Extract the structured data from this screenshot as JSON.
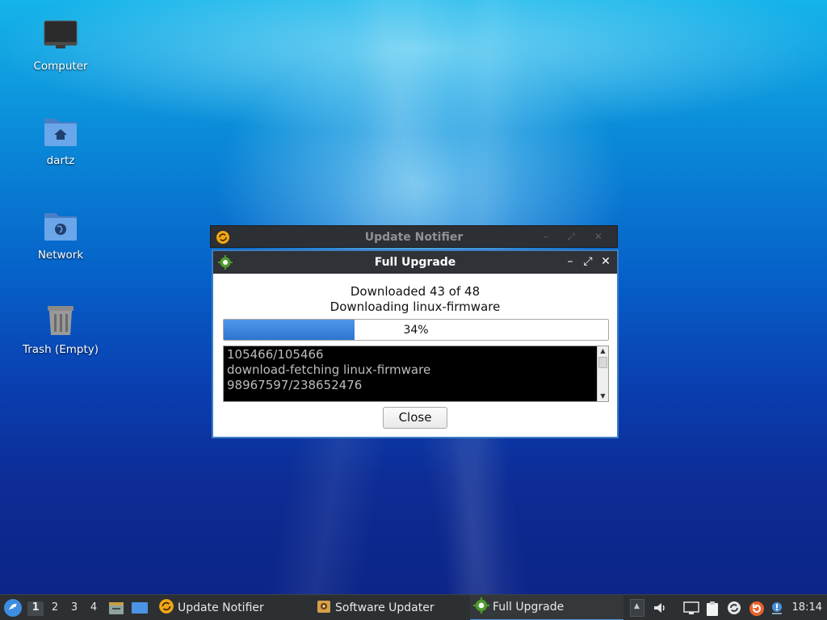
{
  "desktop": {
    "icons": [
      {
        "label": "Computer",
        "icon": "computer-icon"
      },
      {
        "label": "dartz",
        "icon": "home-folder-icon"
      },
      {
        "label": "Network",
        "icon": "network-folder-icon"
      },
      {
        "label": "Trash (Empty)",
        "icon": "trash-icon"
      }
    ]
  },
  "background_window": {
    "title": "Update Notifier",
    "icon": "update-notifier-icon"
  },
  "dialog": {
    "title": "Full Upgrade",
    "icon": "gear-icon",
    "status_line1": "Downloaded 43 of 48",
    "status_line2": "Downloading linux-firmware",
    "progress_percent": 34,
    "progress_label": "34%",
    "log_lines": [
      "105466/105466",
      "download-fetching linux-firmware",
      "98967597/238652476"
    ],
    "close_label": "Close",
    "controls": {
      "minimize": "–",
      "maximize": "⤢",
      "close": "✕"
    }
  },
  "taskbar": {
    "workspaces": [
      "1",
      "2",
      "3",
      "4"
    ],
    "active_workspace": "1",
    "tasks": [
      {
        "label": "Update Notifier",
        "icon": "update-notifier-icon"
      },
      {
        "label": "Software Updater",
        "icon": "software-updater-icon"
      },
      {
        "label": "Full Upgrade",
        "icon": "gear-icon",
        "active": true
      }
    ],
    "clock": "18:14"
  },
  "colors": {
    "accent": "#3b7fc4",
    "progress_fill": "#3a82de",
    "titlebar": "#2f3237",
    "taskbar": "#2c3033"
  }
}
